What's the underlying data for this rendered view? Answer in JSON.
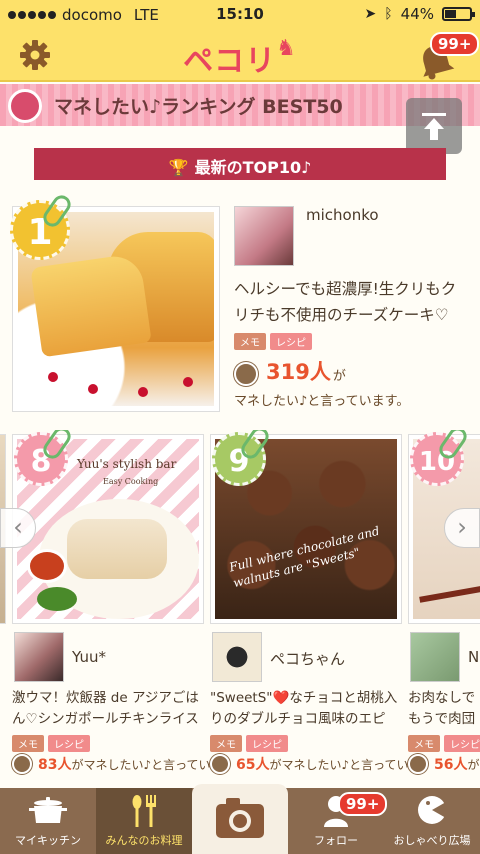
{
  "status": {
    "carrier": "docomo",
    "network": "LTE",
    "time": "15:10",
    "battery": "44%",
    "battery_level": 0.44
  },
  "header": {
    "logo": "ペコリ",
    "notification_badge": "99+"
  },
  "ranking": {
    "title": "マネしたい♪ランキング BEST50",
    "ribbon": "最新のTOP10♪"
  },
  "featured": {
    "rank": "1",
    "user": "michonko",
    "title": "ヘルシーでも超濃厚!生クリもクリチも不使用のチーズケーキ♡",
    "tags": [
      "メモ",
      "レシピ"
    ],
    "count": "319人",
    "count_suffix": "が",
    "say": "マネしたい♪と言っています。"
  },
  "cards": [
    {
      "rank": "8",
      "user": "Yuu*",
      "title": "激ウマ！炊飯器 de アジアごはん♡シンガポールチキンライス",
      "photo_caption": "Yuu's stylish bar",
      "photo_sub": "Easy Cooking",
      "tags": [
        "メモ",
        "レシピ"
      ],
      "count": "83人",
      "say": "がマネしたい♪と言ってい"
    },
    {
      "rank": "9",
      "user": "ペコちゃん",
      "title": "\"SweetS\"❤️なチョコと胡桃入りのダブルチョコ風味のエピ",
      "photo_caption": "Full where chocolate and walnuts are \"Sweets\"",
      "tags": [
        "メモ",
        "レシピ"
      ],
      "count": "65人",
      "say": "がマネしたい♪と言ってい"
    },
    {
      "rank": "10",
      "user": "N",
      "title": "お肉なしでもうで肉団子風",
      "tags": [
        "メモ",
        "レシピ"
      ],
      "count": "56人",
      "say": "が"
    }
  ],
  "tabs": [
    {
      "label": "マイキッチン",
      "icon": "pot-icon"
    },
    {
      "label": "みんなのお料理",
      "icon": "spoon-fork-icon"
    },
    {
      "label": "",
      "icon": "camera-icon"
    },
    {
      "label": "フォロー",
      "icon": "follow-icon",
      "badge": "99+"
    },
    {
      "label": "おしゃべり広場",
      "icon": "chat-icon"
    }
  ]
}
